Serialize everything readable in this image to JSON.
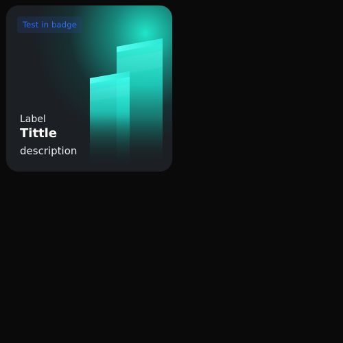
{
  "card": {
    "badge": "Test in badge",
    "label": "Label",
    "title": "Tittle",
    "description": "description",
    "illustration_icon": "bar-chart-icon",
    "colors": {
      "accent": "#1ff0d4",
      "badge_text": "#2f6df3",
      "card_bg": "#1c1f23",
      "page_bg": "#0a0a0a"
    }
  }
}
